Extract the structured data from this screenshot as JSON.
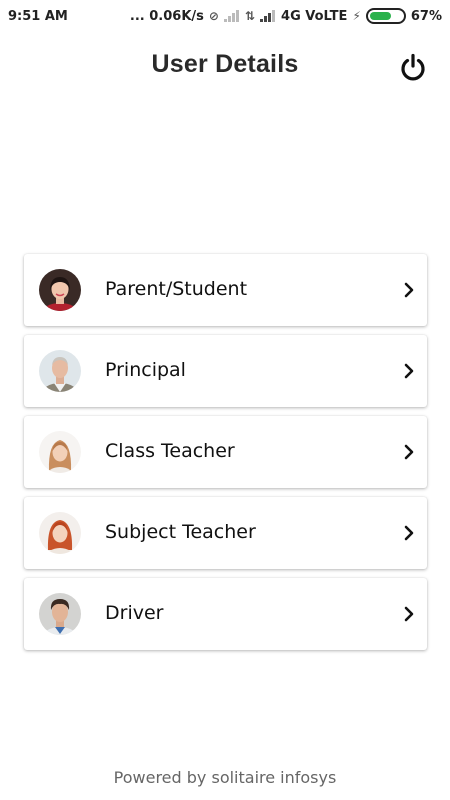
{
  "status_bar": {
    "time": "9:51 AM",
    "speed": "... 0.06K/s",
    "network": "4G VoLTE",
    "battery_text": "67%",
    "battery_level": 0.67,
    "battery_color": "#2bb24c"
  },
  "header": {
    "title": "User Details",
    "power_icon": "power-icon"
  },
  "users": [
    {
      "label": "Parent/Student",
      "icon": "parent-student-avatar"
    },
    {
      "label": "Principal",
      "icon": "principal-avatar"
    },
    {
      "label": "Class Teacher",
      "icon": "class-teacher-avatar"
    },
    {
      "label": "Subject Teacher",
      "icon": "subject-teacher-avatar"
    },
    {
      "label": "Driver",
      "icon": "driver-avatar"
    }
  ],
  "footer": {
    "text": "Powered by solitaire infosys"
  }
}
